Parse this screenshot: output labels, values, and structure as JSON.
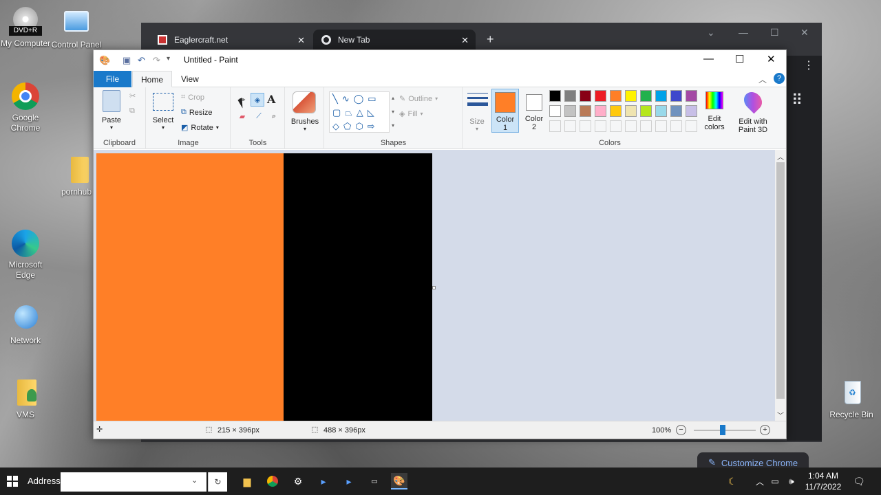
{
  "desktop": {
    "icons": [
      {
        "label": "My Computer",
        "badge": "DVD+R"
      },
      {
        "label": "Control Panel"
      },
      {
        "label": "Google Chrome"
      },
      {
        "label": "pornhub"
      },
      {
        "label": "Microsoft Edge"
      },
      {
        "label": "Network"
      },
      {
        "label": "VMS"
      },
      {
        "label": "Recycle Bin"
      }
    ]
  },
  "chrome": {
    "tabs": [
      {
        "title": "Eaglercraft.net"
      },
      {
        "title": "New Tab"
      }
    ],
    "new_tab_symbol": "+",
    "customize_label": "Customize Chrome"
  },
  "paint": {
    "title": "Untitled - Paint",
    "ribbon_tabs": [
      "File",
      "Home",
      "View"
    ],
    "clipboard": {
      "paste": "Paste",
      "group": "Clipboard"
    },
    "image": {
      "select": "Select",
      "crop": "Crop",
      "resize": "Resize",
      "rotate": "Rotate",
      "group": "Image"
    },
    "tools": {
      "group": "Tools"
    },
    "brushes": {
      "label": "Brushes"
    },
    "shapes": {
      "outline": "Outline",
      "fill": "Fill",
      "group": "Shapes"
    },
    "size": {
      "label": "Size"
    },
    "color1": {
      "label": "Color",
      "num": "1",
      "value": "#ff7f27"
    },
    "color2": {
      "label": "Color",
      "num": "2",
      "value": "#ffffff"
    },
    "colors_group": "Colors",
    "edit_colors": [
      "Edit",
      "colors"
    ],
    "edit_paint3d": [
      "Edit with",
      "Paint 3D"
    ],
    "palette_row1": [
      "#000000",
      "#7f7f7f",
      "#880015",
      "#ed1c24",
      "#ff7f27",
      "#fff200",
      "#22b14c",
      "#00a2e8",
      "#3f48cc",
      "#a349a4"
    ],
    "palette_row2": [
      "#ffffff",
      "#c3c3c3",
      "#b97a57",
      "#ffaec9",
      "#ffc90e",
      "#efe4b0",
      "#b5e61d",
      "#99d9ea",
      "#7092be",
      "#c8bfe7"
    ],
    "palette_row3": [
      "#f5f6f7",
      "#f5f6f7",
      "#f5f6f7",
      "#f5f6f7",
      "#f5f6f7",
      "#f5f6f7",
      "#f5f6f7",
      "#f5f6f7",
      "#f5f6f7",
      "#f5f6f7"
    ],
    "canvas": {
      "fill_left": "#ff7f27",
      "fill_right": "#000000"
    },
    "status": {
      "selection": "215 × 396px",
      "canvas_size": "488 × 396px",
      "zoom": "100%"
    }
  },
  "taskbar": {
    "address_label": "Address",
    "address_value": "",
    "time": "1:04 AM",
    "date": "11/7/2022"
  }
}
